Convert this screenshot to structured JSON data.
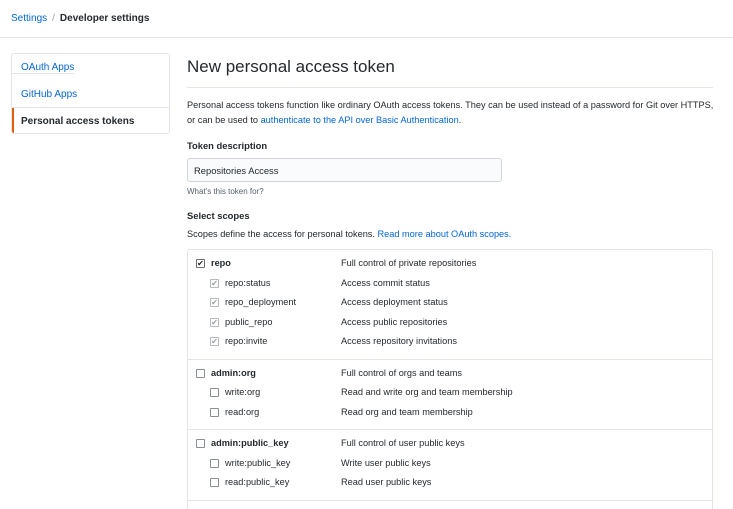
{
  "breadcrumb": {
    "settings": "Settings",
    "separator": "/",
    "current": "Developer settings"
  },
  "sidebar": {
    "items": [
      {
        "label": "OAuth Apps"
      },
      {
        "label": "GitHub Apps"
      },
      {
        "label": "Personal access tokens"
      }
    ]
  },
  "page": {
    "title": "New personal access token",
    "intro_text": "Personal access tokens function like ordinary OAuth access tokens. They can be used instead of a password for Git over HTTPS, or can be used to ",
    "intro_link": "authenticate to the API over Basic Authentication",
    "intro_end": "."
  },
  "token": {
    "label": "Token description",
    "value": "Repositories Access",
    "hint": "What's this token for?"
  },
  "scopes": {
    "heading": "Select scopes",
    "note_text": "Scopes define the access for personal tokens. ",
    "note_link": "Read more about OAuth scopes.",
    "groups": [
      {
        "parent": {
          "name": "repo",
          "desc": "Full control of private repositories",
          "checked": true
        },
        "children": [
          {
            "name": "repo:status",
            "desc": "Access commit status",
            "checked": true
          },
          {
            "name": "repo_deployment",
            "desc": "Access deployment status",
            "checked": true
          },
          {
            "name": "public_repo",
            "desc": "Access public repositories",
            "checked": true
          },
          {
            "name": "repo:invite",
            "desc": "Access repository invitations",
            "checked": true
          }
        ]
      },
      {
        "parent": {
          "name": "admin:org",
          "desc": "Full control of orgs and teams",
          "checked": false
        },
        "children": [
          {
            "name": "write:org",
            "desc": "Read and write org and team membership",
            "checked": false
          },
          {
            "name": "read:org",
            "desc": "Read org and team membership",
            "checked": false
          }
        ]
      },
      {
        "parent": {
          "name": "admin:public_key",
          "desc": "Full control of user public keys",
          "checked": false
        },
        "children": [
          {
            "name": "write:public_key",
            "desc": "Write user public keys",
            "checked": false
          },
          {
            "name": "read:public_key",
            "desc": "Read user public keys",
            "checked": false
          }
        ]
      }
    ]
  },
  "colors": {
    "link": "#0366d6",
    "border": "#e1e4e8",
    "selected_accent": "#e36209"
  }
}
